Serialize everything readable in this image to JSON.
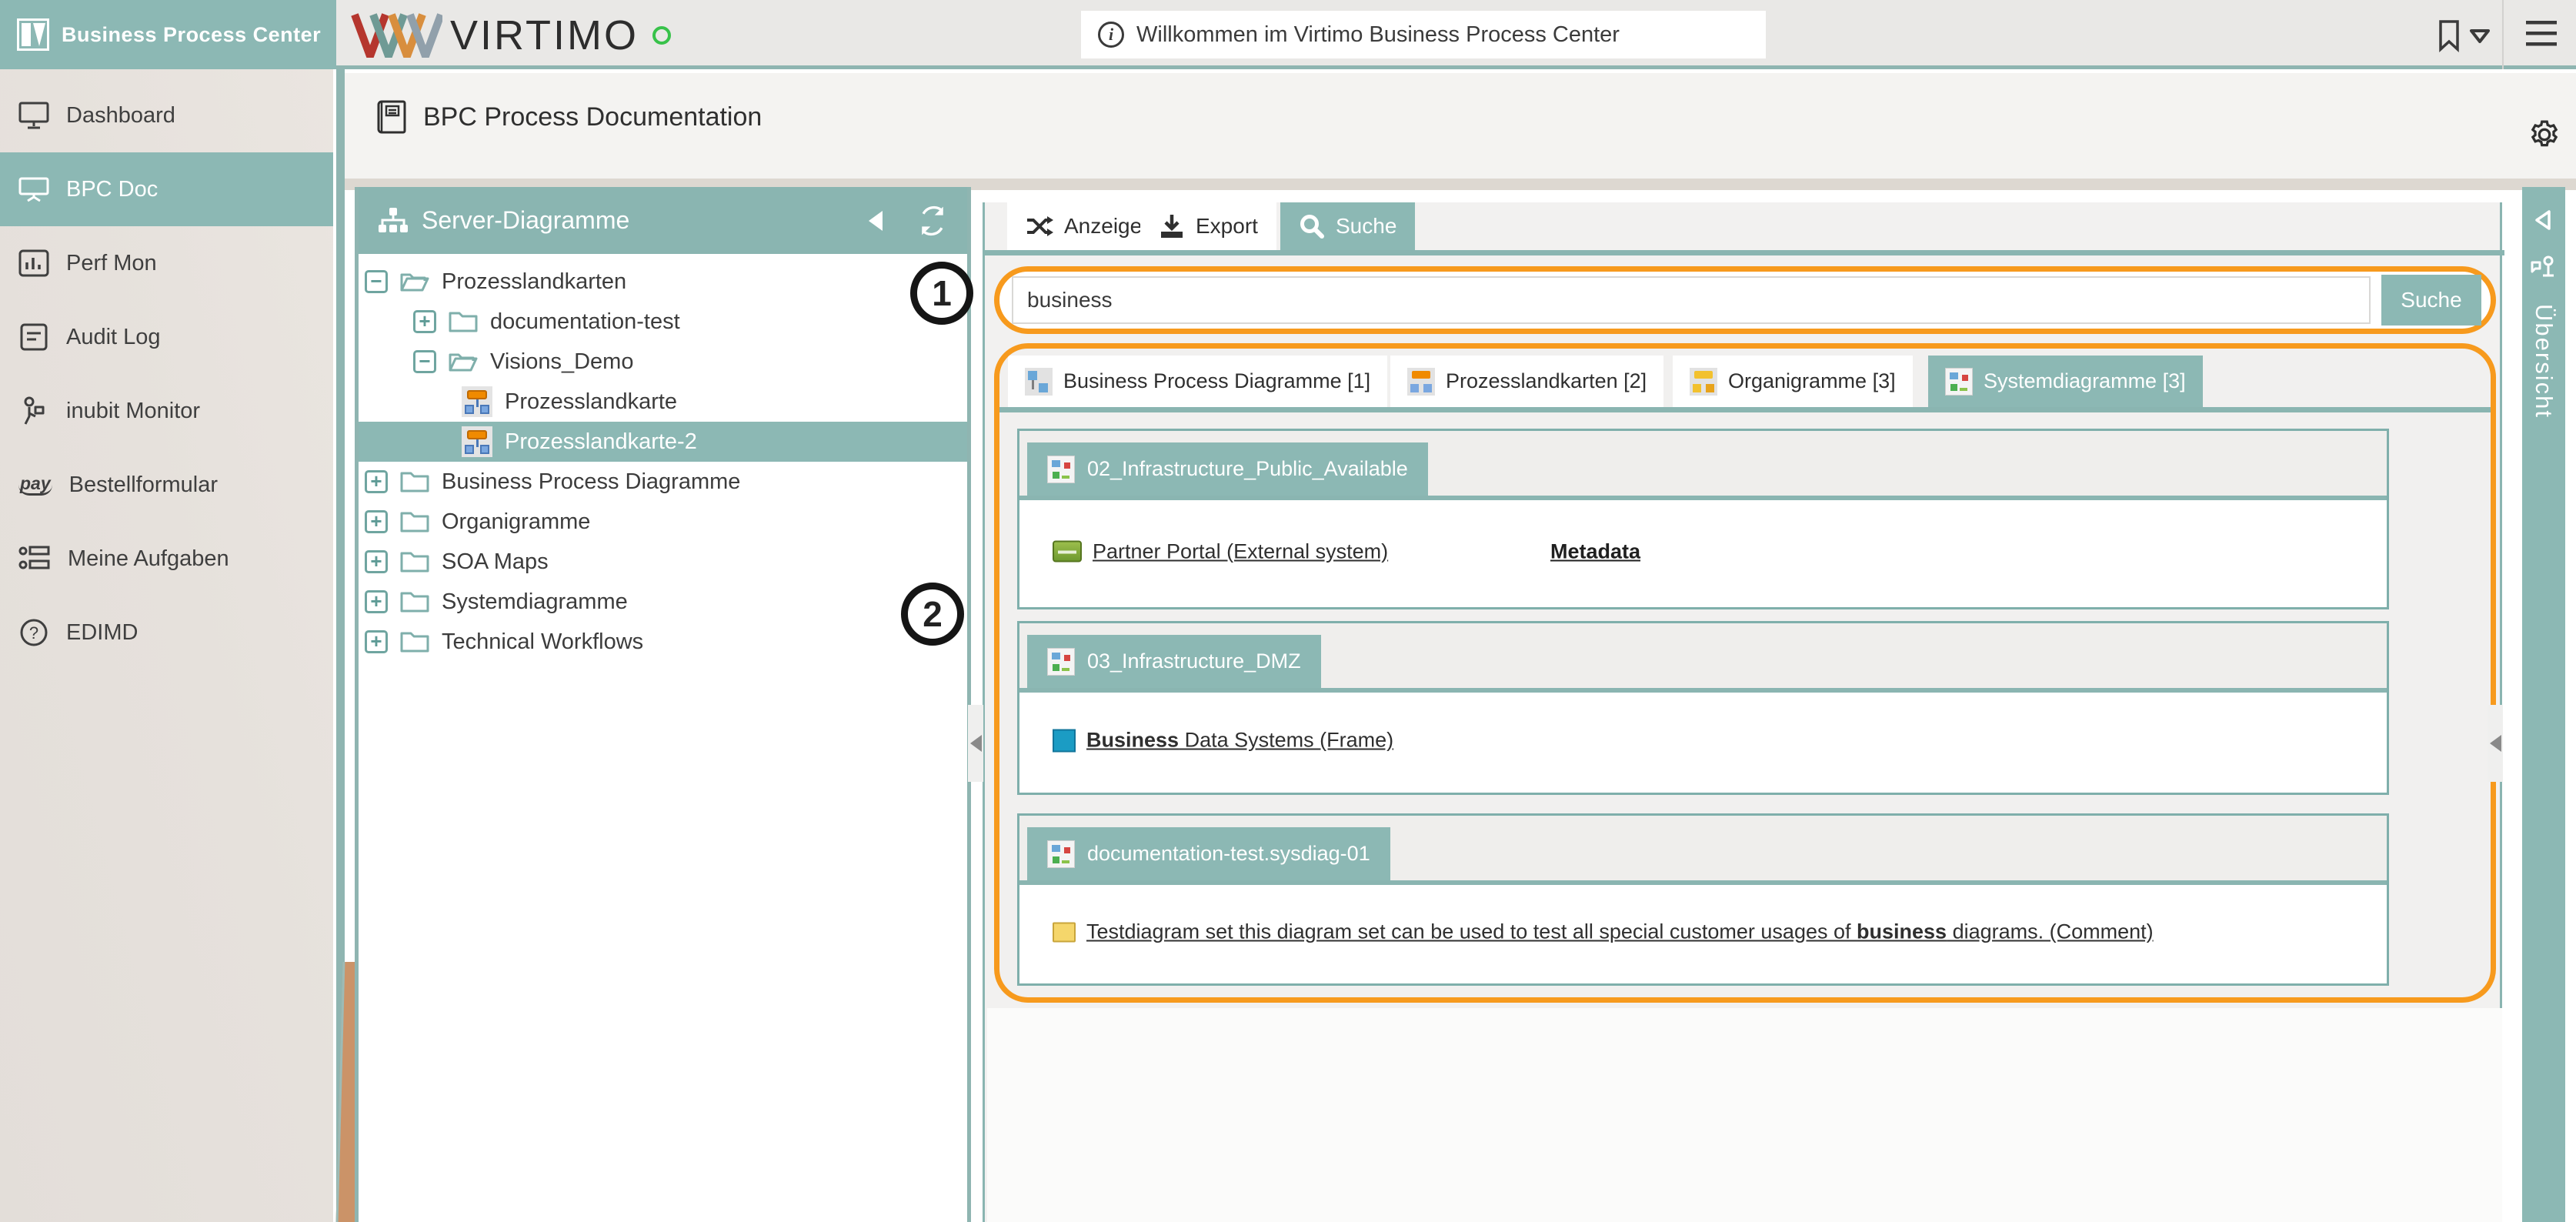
{
  "brand": {
    "title": "Business Process Center"
  },
  "header": {
    "logo_text": "VIRTIMO",
    "notification": "Willkommen im Virtimo Business Process Center",
    "info_glyph": "i"
  },
  "page": {
    "title": "BPC Process Documentation"
  },
  "sidebar": {
    "items": [
      {
        "label": "Dashboard",
        "icon": "monitor-icon",
        "active": false
      },
      {
        "label": "BPC Doc",
        "icon": "presentation-icon",
        "active": true
      },
      {
        "label": "Perf Mon",
        "icon": "bar-chart-icon",
        "active": false
      },
      {
        "label": "Audit Log",
        "icon": "document-icon",
        "active": false
      },
      {
        "label": "inubit Monitor",
        "icon": "person-icon",
        "active": false
      },
      {
        "label": "Bestellformular",
        "icon": "pay-icon",
        "active": false
      },
      {
        "label": "Meine Aufgaben",
        "icon": "tasks-icon",
        "active": false
      },
      {
        "label": "EDIMD",
        "icon": "question-icon",
        "active": false
      }
    ],
    "pay_glyph": "pay"
  },
  "tree": {
    "title": "Server-Diagramme",
    "rows": [
      {
        "label": "Prozesslandkarten",
        "level": 0,
        "expander": "minus",
        "icon": "folder-open",
        "selected": false
      },
      {
        "label": "documentation-test",
        "level": 1,
        "expander": "plus",
        "icon": "folder",
        "selected": false
      },
      {
        "label": "Visions_Demo",
        "level": 1,
        "expander": "minus",
        "icon": "folder-open",
        "selected": false
      },
      {
        "label": "Prozesslandkarte",
        "level": 2,
        "expander": "none",
        "icon": "diagram",
        "selected": false
      },
      {
        "label": "Prozesslandkarte-2",
        "level": 2,
        "expander": "none",
        "icon": "diagram",
        "selected": true
      },
      {
        "label": "Business Process Diagramme",
        "level": 0,
        "expander": "plus",
        "icon": "folder",
        "selected": false
      },
      {
        "label": "Organigramme",
        "level": 0,
        "expander": "plus",
        "icon": "folder",
        "selected": false
      },
      {
        "label": "SOA Maps",
        "level": 0,
        "expander": "plus",
        "icon": "folder",
        "selected": false
      },
      {
        "label": "Systemdiagramme",
        "level": 0,
        "expander": "plus",
        "icon": "folder",
        "selected": false
      },
      {
        "label": "Technical Workflows",
        "level": 0,
        "expander": "plus",
        "icon": "folder",
        "selected": false
      }
    ]
  },
  "toolbar": {
    "anzeige": "Anzeige",
    "export": "Export",
    "suche": "Suche",
    "active_tab": "Suche"
  },
  "search": {
    "value": "business",
    "placeholder": "",
    "button_label": "Suche"
  },
  "result_tabs": [
    {
      "label": "Business Process Diagramme [1]",
      "count": 1,
      "active": false
    },
    {
      "label": "Prozesslandkarten [2]",
      "count": 2,
      "active": false
    },
    {
      "label": "Organigramme [3]",
      "count": 3,
      "active": false
    },
    {
      "label": "Systemdiagramme [3]",
      "count": 3,
      "active": true
    }
  ],
  "groups": [
    {
      "title": "02_Infrastructure_Public_Available",
      "row": {
        "pre": "Partner Portal (External system)",
        "bold": "",
        "post": ""
      },
      "metadata_label": "Metadata",
      "row_icon": "green-server-icon"
    },
    {
      "title": "03_Infrastructure_DMZ",
      "row": {
        "pre": "",
        "bold": "Business",
        "post": " Data Systems (Frame)"
      },
      "metadata_label": "",
      "row_icon": "blue-frame-icon"
    },
    {
      "title": "documentation-test.sysdiag-01",
      "row": {
        "pre": "Testdiagram set this diagram set can be used to test all special customer usages of ",
        "bold": "business",
        "post": " diagrams. (Comment)"
      },
      "metadata_label": "",
      "row_icon": "yellow-note-icon"
    }
  ],
  "annotations": {
    "one": "1",
    "two": "2"
  },
  "overview": {
    "label": "Übersicht"
  },
  "colors": {
    "teal": "#8CB8B4",
    "teal_border": "#7FAFAB",
    "teal_line": "#8FB5B1",
    "orange_annotation": "#F79A1D",
    "sidebar_wedge": "#CB9368",
    "header_bg": "#E9E8E6",
    "pane_bg": "#F2F1F0",
    "logo_green_ring": "#38C24A"
  }
}
